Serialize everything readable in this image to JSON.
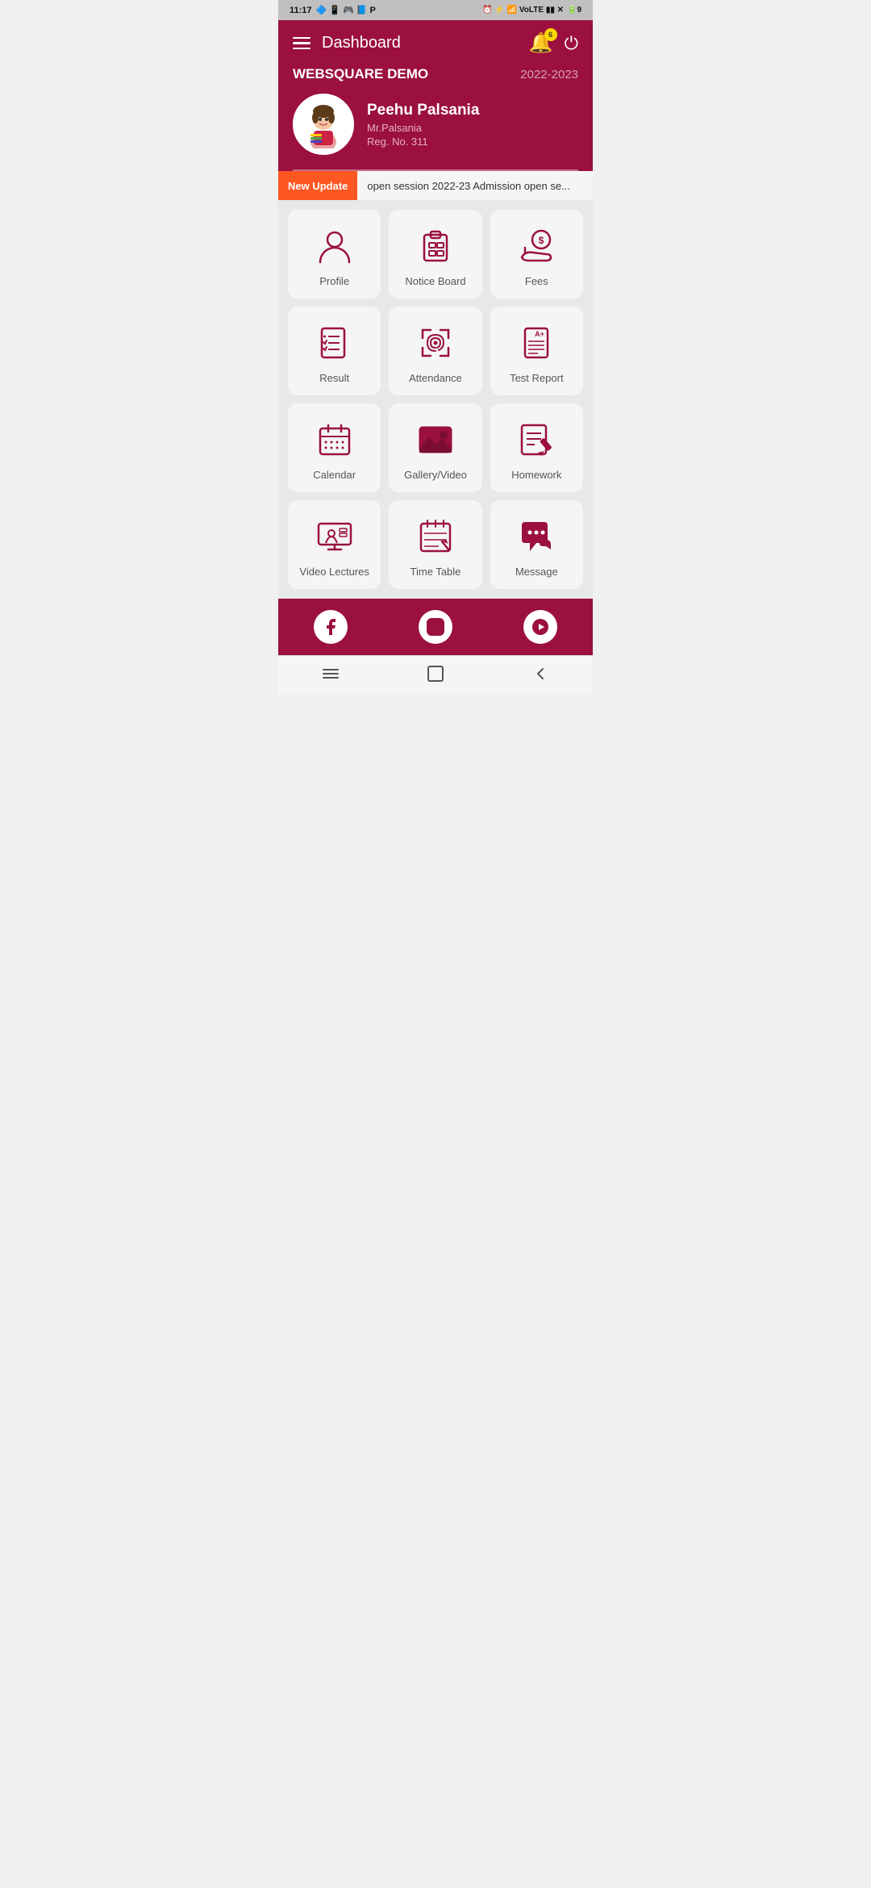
{
  "statusBar": {
    "time": "11:17",
    "batteryLevel": "9"
  },
  "header": {
    "title": "Dashboard",
    "bellBadge": "6",
    "schoolName": "WEBSQUARE DEMO",
    "schoolYear": "2022-2023",
    "studentName": "Peehu Palsania",
    "parentName": "Mr.Palsania",
    "regNo": "Reg. No. 311"
  },
  "updateBar": {
    "label": "New Update",
    "text": "open session 2022-23      Admission open se..."
  },
  "menuItems": [
    {
      "id": "profile",
      "label": "Profile",
      "icon": "person"
    },
    {
      "id": "notice-board",
      "label": "Notice Board",
      "icon": "clipboard"
    },
    {
      "id": "fees",
      "label": "Fees",
      "icon": "money"
    },
    {
      "id": "result",
      "label": "Result",
      "icon": "checklist"
    },
    {
      "id": "attendance",
      "label": "Attendance",
      "icon": "fingerprint"
    },
    {
      "id": "test-report",
      "label": "Test Report",
      "icon": "report"
    },
    {
      "id": "calendar",
      "label": "Calendar",
      "icon": "calendar"
    },
    {
      "id": "gallery",
      "label": "Gallery/Video",
      "icon": "gallery"
    },
    {
      "id": "homework",
      "label": "Homework",
      "icon": "homework"
    },
    {
      "id": "video-lectures",
      "label": "Video Lectures",
      "icon": "video"
    },
    {
      "id": "time-table",
      "label": "Time Table",
      "icon": "timetable"
    },
    {
      "id": "message",
      "label": "Message",
      "icon": "chat"
    }
  ],
  "socialBar": {
    "facebook": "Facebook",
    "instagram": "Instagram",
    "youtube": "YouTube"
  },
  "navBar": {
    "menu": "Menu",
    "home": "Home",
    "back": "Back"
  }
}
